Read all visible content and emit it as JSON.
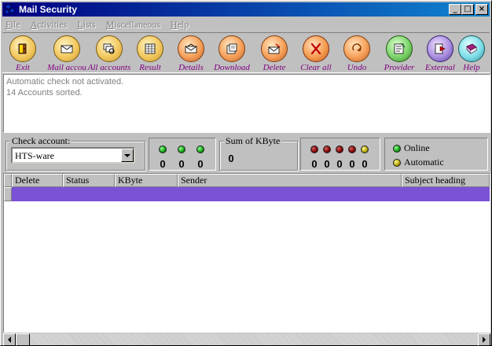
{
  "window": {
    "title": "Mail Security",
    "controls": {
      "minimize": "_",
      "maximize": "□",
      "close": "×"
    }
  },
  "menu": [
    {
      "label": "File",
      "underline": "F",
      "rest": "ile"
    },
    {
      "label": "Activities",
      "underline": "A",
      "rest": "ctivities"
    },
    {
      "label": "Lists",
      "underline": "L",
      "rest": "ists"
    },
    {
      "label": "Miscellaneous",
      "underline": "M",
      "rest": "iscellaneous"
    },
    {
      "label": "Help",
      "underline": "H",
      "rest": "elp"
    }
  ],
  "toolbar": [
    {
      "label": "Exit",
      "icon": "door-icon",
      "color": "#f2c85e"
    },
    {
      "label": "Mail accou",
      "icon": "mail-account-icon",
      "color": "#f2c85e"
    },
    {
      "label": "All accounts",
      "icon": "all-accounts-icon",
      "color": "#f2c85e"
    },
    {
      "label": "Result",
      "icon": "result-table-icon",
      "color": "#f2c85e"
    },
    {
      "label": "Details",
      "icon": "envelope-details-icon",
      "color": "#f6a05a"
    },
    {
      "label": "Download",
      "icon": "download-icon",
      "color": "#f6a05a"
    },
    {
      "label": "Delete",
      "icon": "delete-mail-icon",
      "color": "#f6a05a"
    },
    {
      "label": "Clear all",
      "icon": "clear-all-icon",
      "color": "#f59c50"
    },
    {
      "label": "Undo",
      "icon": "undo-icon",
      "color": "#f6a05a"
    },
    {
      "label": "Provider",
      "icon": "provider-icon",
      "color": "#7cd36a"
    },
    {
      "label": "External",
      "icon": "external-icon",
      "color": "#a98ee0"
    },
    {
      "label": "Help",
      "icon": "help-book-icon",
      "color": "#7fdfe8"
    }
  ],
  "log": {
    "lines": [
      "Automatic check not activated.",
      "14 Accounts sorted."
    ]
  },
  "check_account": {
    "title": "Check account:",
    "selected": "HTS-ware",
    "counters": [
      "0",
      "0",
      "0"
    ]
  },
  "sum": {
    "title": "Sum of KByte",
    "value": "0"
  },
  "red_counters": [
    "0",
    "0",
    "0",
    "0",
    "0"
  ],
  "legend": {
    "online": "Online",
    "automatic": "Automatic"
  },
  "table": {
    "columns": [
      "Delete",
      "Status",
      "KByte",
      "Sender",
      "Subject heading"
    ],
    "selected_row_color": "#7a52d6"
  }
}
